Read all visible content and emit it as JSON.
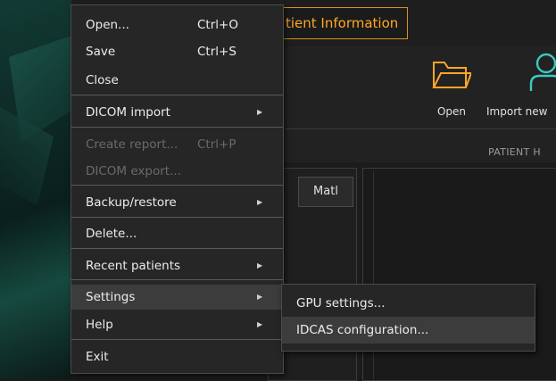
{
  "app": {
    "active_tab": "tient Information",
    "ribbon": {
      "open_label": "Open",
      "import_label": "Import new",
      "group_label": "PATIENT H",
      "folder_icon": "folder-open-icon",
      "user_icon": "add-patient-icon",
      "accent_color": "#ffa726"
    },
    "panel_tab": "Matl"
  },
  "file_menu": {
    "open": {
      "label": "Open...",
      "shortcut": "Ctrl+O"
    },
    "save": {
      "label": "Save",
      "shortcut": "Ctrl+S"
    },
    "close": {
      "label": "Close"
    },
    "dicom_import": {
      "label": "DICOM import"
    },
    "create_report": {
      "label": "Create report...",
      "shortcut": "Ctrl+P"
    },
    "dicom_export": {
      "label": "DICOM export..."
    },
    "backup_restore": {
      "label": "Backup/restore"
    },
    "delete": {
      "label": "Delete..."
    },
    "recent_patients": {
      "label": "Recent patients"
    },
    "settings": {
      "label": "Settings"
    },
    "help": {
      "label": "Help"
    },
    "exit": {
      "label": "Exit"
    },
    "submenu_arrow": "▶"
  },
  "settings_submenu": {
    "gpu": {
      "label": "GPU settings..."
    },
    "idcas": {
      "label": "IDCAS configuration..."
    }
  }
}
